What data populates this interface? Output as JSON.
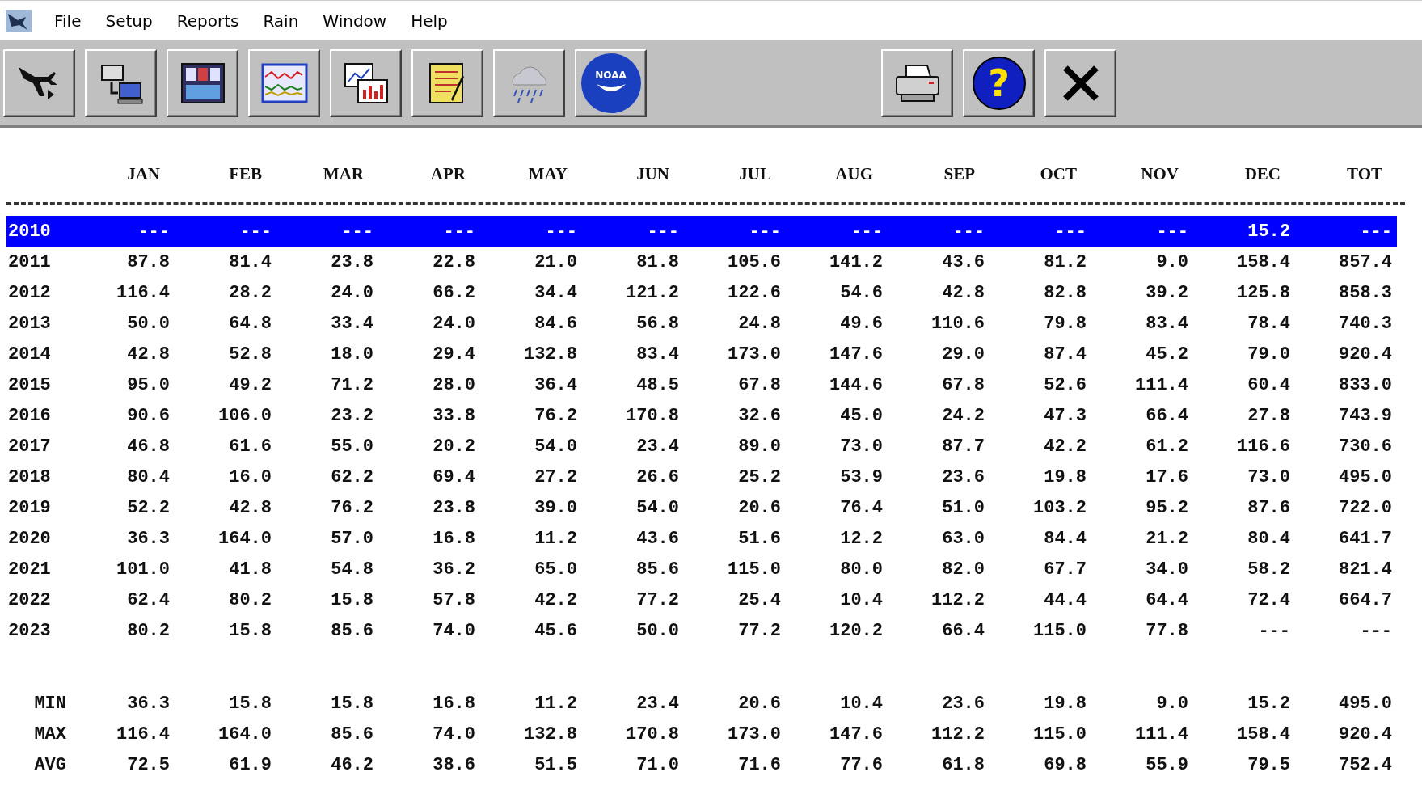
{
  "menu": [
    "File",
    "Setup",
    "Reports",
    "Rain",
    "Window",
    "Help"
  ],
  "toolbar": {
    "left": [
      {
        "kind": "plane"
      },
      {
        "kind": "computer"
      },
      {
        "kind": "panel"
      },
      {
        "kind": "chart"
      },
      {
        "kind": "window-chart"
      },
      {
        "kind": "notepad"
      },
      {
        "kind": "rain"
      },
      {
        "kind": "logo",
        "text": "NOAA"
      }
    ],
    "right": [
      {
        "kind": "printer"
      },
      {
        "kind": "help",
        "text": "?"
      },
      {
        "kind": "close"
      }
    ]
  },
  "table": {
    "columns": [
      "JAN",
      "FEB",
      "MAR",
      "APR",
      "MAY",
      "JUN",
      "JUL",
      "AUG",
      "SEP",
      "OCT",
      "NOV",
      "DEC",
      "TOT"
    ],
    "rows": [
      {
        "year": "2010",
        "selected": true,
        "values": [
          "---",
          "---",
          "---",
          "---",
          "---",
          "---",
          "---",
          "---",
          "---",
          "---",
          "---",
          "15.2",
          "---"
        ]
      },
      {
        "year": "2011",
        "selected": false,
        "values": [
          "87.8",
          "81.4",
          "23.8",
          "22.8",
          "21.0",
          "81.8",
          "105.6",
          "141.2",
          "43.6",
          "81.2",
          "9.0",
          "158.4",
          "857.4"
        ]
      },
      {
        "year": "2012",
        "selected": false,
        "values": [
          "116.4",
          "28.2",
          "24.0",
          "66.2",
          "34.4",
          "121.2",
          "122.6",
          "54.6",
          "42.8",
          "82.8",
          "39.2",
          "125.8",
          "858.3"
        ]
      },
      {
        "year": "2013",
        "selected": false,
        "values": [
          "50.0",
          "64.8",
          "33.4",
          "24.0",
          "84.6",
          "56.8",
          "24.8",
          "49.6",
          "110.6",
          "79.8",
          "83.4",
          "78.4",
          "740.3"
        ]
      },
      {
        "year": "2014",
        "selected": false,
        "values": [
          "42.8",
          "52.8",
          "18.0",
          "29.4",
          "132.8",
          "83.4",
          "173.0",
          "147.6",
          "29.0",
          "87.4",
          "45.2",
          "79.0",
          "920.4"
        ]
      },
      {
        "year": "2015",
        "selected": false,
        "values": [
          "95.0",
          "49.2",
          "71.2",
          "28.0",
          "36.4",
          "48.5",
          "67.8",
          "144.6",
          "67.8",
          "52.6",
          "111.4",
          "60.4",
          "833.0"
        ]
      },
      {
        "year": "2016",
        "selected": false,
        "values": [
          "90.6",
          "106.0",
          "23.2",
          "33.8",
          "76.2",
          "170.8",
          "32.6",
          "45.0",
          "24.2",
          "47.3",
          "66.4",
          "27.8",
          "743.9"
        ]
      },
      {
        "year": "2017",
        "selected": false,
        "values": [
          "46.8",
          "61.6",
          "55.0",
          "20.2",
          "54.0",
          "23.4",
          "89.0",
          "73.0",
          "87.7",
          "42.2",
          "61.2",
          "116.6",
          "730.6"
        ]
      },
      {
        "year": "2018",
        "selected": false,
        "values": [
          "80.4",
          "16.0",
          "62.2",
          "69.4",
          "27.2",
          "26.6",
          "25.2",
          "53.9",
          "23.6",
          "19.8",
          "17.6",
          "73.0",
          "495.0"
        ]
      },
      {
        "year": "2019",
        "selected": false,
        "values": [
          "52.2",
          "42.8",
          "76.2",
          "23.8",
          "39.0",
          "54.0",
          "20.6",
          "76.4",
          "51.0",
          "103.2",
          "95.2",
          "87.6",
          "722.0"
        ]
      },
      {
        "year": "2020",
        "selected": false,
        "values": [
          "36.3",
          "164.0",
          "57.0",
          "16.8",
          "11.2",
          "43.6",
          "51.6",
          "12.2",
          "63.0",
          "84.4",
          "21.2",
          "80.4",
          "641.7"
        ]
      },
      {
        "year": "2021",
        "selected": false,
        "values": [
          "101.0",
          "41.8",
          "54.8",
          "36.2",
          "65.0",
          "85.6",
          "115.0",
          "80.0",
          "82.0",
          "67.7",
          "34.0",
          "58.2",
          "821.4"
        ]
      },
      {
        "year": "2022",
        "selected": false,
        "values": [
          "62.4",
          "80.2",
          "15.8",
          "57.8",
          "42.2",
          "77.2",
          "25.4",
          "10.4",
          "112.2",
          "44.4",
          "64.4",
          "72.4",
          "664.7"
        ]
      },
      {
        "year": "2023",
        "selected": false,
        "values": [
          "80.2",
          "15.8",
          "85.6",
          "74.0",
          "45.6",
          "50.0",
          "77.2",
          "120.2",
          "66.4",
          "115.0",
          "77.8",
          "---",
          "---"
        ]
      }
    ],
    "summary": [
      {
        "label": "MIN",
        "values": [
          "36.3",
          "15.8",
          "15.8",
          "16.8",
          "11.2",
          "23.4",
          "20.6",
          "10.4",
          "23.6",
          "19.8",
          "9.0",
          "15.2",
          "495.0"
        ]
      },
      {
        "label": "MAX",
        "values": [
          "116.4",
          "164.0",
          "85.6",
          "74.0",
          "132.8",
          "170.8",
          "173.0",
          "147.6",
          "112.2",
          "115.0",
          "111.4",
          "158.4",
          "920.4"
        ]
      },
      {
        "label": "AVG",
        "values": [
          "72.5",
          "61.9",
          "46.2",
          "38.6",
          "51.5",
          "71.0",
          "71.6",
          "77.6",
          "61.8",
          "69.8",
          "55.9",
          "79.5",
          "752.4"
        ]
      }
    ]
  }
}
